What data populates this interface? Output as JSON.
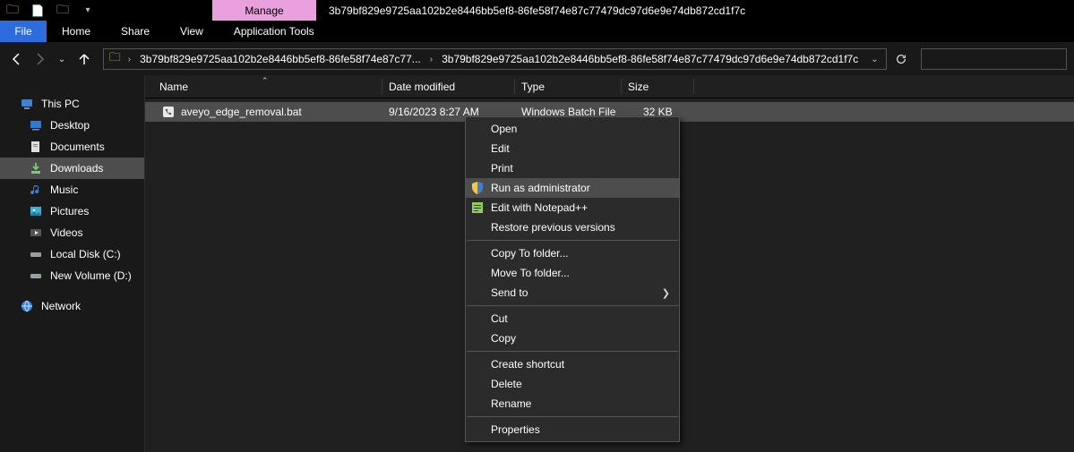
{
  "title": "3b79bf829e9725aa102b2e8446bb5ef8-86fe58f74e87c77479dc97d6e9e74db872cd1f7c",
  "ribbon_context_tab": "Manage",
  "menu": {
    "file": "File",
    "items": [
      "Home",
      "Share",
      "View",
      "Application Tools"
    ]
  },
  "address": {
    "crumb_short": "3b79bf829e9725aa102b2e8446bb5ef8-86fe58f74e87c77...",
    "crumb_full": "3b79bf829e9725aa102b2e8446bb5ef8-86fe58f74e87c77479dc97d6e9e74db872cd1f7c"
  },
  "sidebar": {
    "root": "This PC",
    "items": [
      {
        "label": "Desktop"
      },
      {
        "label": "Documents"
      },
      {
        "label": "Downloads",
        "selected": true
      },
      {
        "label": "Music"
      },
      {
        "label": "Pictures"
      },
      {
        "label": "Videos"
      },
      {
        "label": "Local Disk (C:)"
      },
      {
        "label": "New Volume (D:)"
      }
    ],
    "network": "Network"
  },
  "columns": {
    "name": "Name",
    "date": "Date modified",
    "type": "Type",
    "size": "Size"
  },
  "file": {
    "name": "aveyo_edge_removal.bat",
    "date": "9/16/2023 8:27 AM",
    "type": "Windows Batch File",
    "size": "32 KB"
  },
  "context_menu": {
    "open": "Open",
    "edit": "Edit",
    "print": "Print",
    "run_admin": "Run as administrator",
    "edit_npp": "Edit with Notepad++",
    "restore": "Restore previous versions",
    "copy_to": "Copy To folder...",
    "move_to": "Move To folder...",
    "send_to": "Send to",
    "cut": "Cut",
    "copy": "Copy",
    "shortcut": "Create shortcut",
    "delete": "Delete",
    "rename": "Rename",
    "properties": "Properties"
  }
}
